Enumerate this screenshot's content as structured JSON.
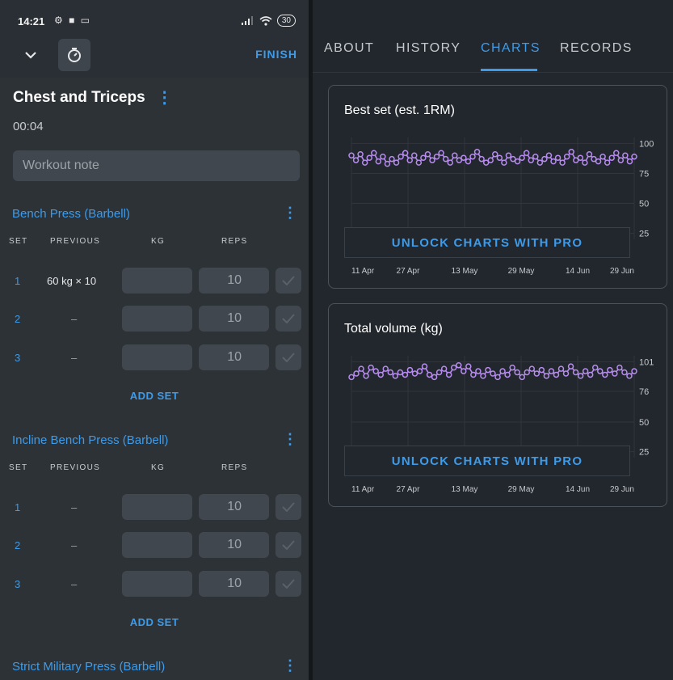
{
  "status": {
    "time": "14:21",
    "battery": "30"
  },
  "toolbar": {
    "finish_label": "FINISH"
  },
  "workout": {
    "title": "Chest and Triceps",
    "elapsed": "00:04",
    "note_placeholder": "Workout note"
  },
  "columns": {
    "set": "SET",
    "previous": "PREVIOUS",
    "kg": "KG",
    "reps": "REPS"
  },
  "exercises": [
    {
      "name": "Bench Press (Barbell)",
      "sets": [
        {
          "set": "1",
          "previous": "60 kg × 10",
          "reps": "10"
        },
        {
          "set": "2",
          "previous": "–",
          "reps": "10"
        },
        {
          "set": "3",
          "previous": "–",
          "reps": "10"
        }
      ],
      "add_label": "ADD SET"
    },
    {
      "name": "Incline Bench Press (Barbell)",
      "sets": [
        {
          "set": "1",
          "previous": "–",
          "reps": "10"
        },
        {
          "set": "2",
          "previous": "–",
          "reps": "10"
        },
        {
          "set": "3",
          "previous": "–",
          "reps": "10"
        }
      ],
      "add_label": "ADD SET"
    },
    {
      "name": "Strict Military Press (Barbell)"
    }
  ],
  "tabs": [
    "ABOUT",
    "HISTORY",
    "CHARTS",
    "RECORDS"
  ],
  "active_tab": "CHARTS",
  "unlock_label": "UNLOCK CHARTS WITH PRO",
  "colors": {
    "accent": "#3d9be9",
    "series": "#b88cf0"
  },
  "chart_data": [
    {
      "type": "line",
      "title": "Best set (est. 1RM)",
      "x_ticks": [
        "11 Apr",
        "27 Apr",
        "13 May",
        "29 May",
        "14 Jun",
        "29 Jun"
      ],
      "y_ticks": [
        "100",
        "75",
        "50",
        "25"
      ],
      "ylim": [
        20,
        105
      ],
      "grid": true,
      "values": [
        90,
        86,
        91,
        84,
        88,
        92,
        85,
        89,
        83,
        87,
        84,
        89,
        92,
        86,
        90,
        84,
        88,
        91,
        86,
        89,
        92,
        87,
        84,
        90,
        86,
        88,
        85,
        89,
        93,
        87,
        84,
        86,
        91,
        88,
        84,
        90,
        87,
        85,
        88,
        92,
        86,
        89,
        84,
        87,
        90,
        85,
        88,
        84,
        89,
        93,
        86,
        88,
        84,
        91,
        87,
        85,
        89,
        84,
        88,
        92,
        86,
        90,
        85,
        89
      ]
    },
    {
      "type": "line",
      "title": "Total volume (kg)",
      "x_ticks": [
        "11 Apr",
        "27 Apr",
        "13 May",
        "29 May",
        "14 Jun",
        "29 Jun"
      ],
      "y_ticks": [
        "101",
        "76",
        "50",
        "25"
      ],
      "ylim": [
        20,
        106
      ],
      "grid": true,
      "values": [
        88,
        91,
        95,
        89,
        96,
        93,
        90,
        95,
        92,
        89,
        92,
        90,
        94,
        91,
        93,
        97,
        90,
        88,
        92,
        95,
        90,
        96,
        98,
        93,
        97,
        90,
        93,
        89,
        94,
        91,
        88,
        93,
        90,
        96,
        92,
        88,
        92,
        95,
        91,
        94,
        89,
        93,
        90,
        95,
        91,
        97,
        92,
        89,
        93,
        90,
        96,
        93,
        90,
        94,
        91,
        96,
        92,
        89,
        93
      ]
    }
  ]
}
